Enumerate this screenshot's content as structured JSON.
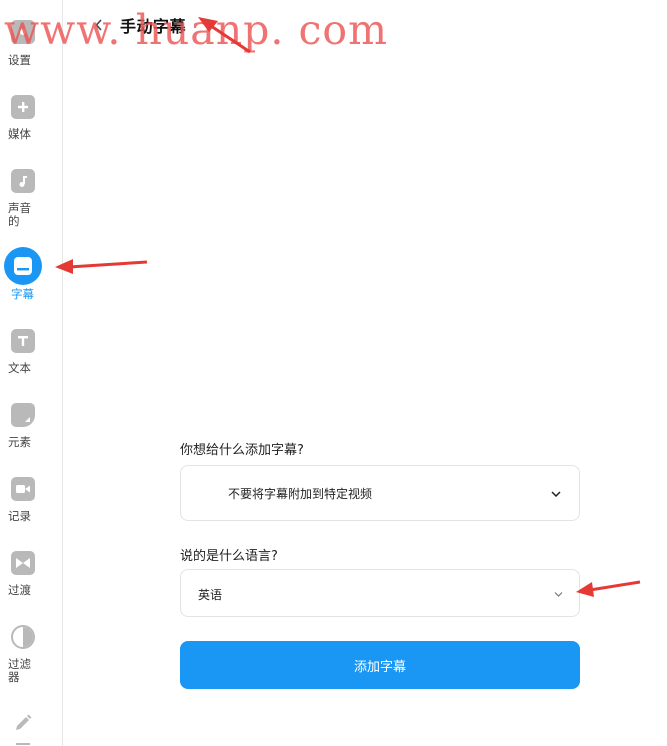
{
  "sidebar": {
    "items": [
      {
        "label": "设置",
        "icon": "settings-icon"
      },
      {
        "label": "媒体",
        "icon": "plus-icon"
      },
      {
        "label": "声音的",
        "label_line1": "声音",
        "label_line2": "的",
        "icon": "music-note-icon"
      },
      {
        "label": "字幕",
        "icon": "subtitles-icon",
        "active": true
      },
      {
        "label": "文本",
        "icon": "text-icon"
      },
      {
        "label": "元素",
        "icon": "shapes-icon"
      },
      {
        "label": "记录",
        "icon": "record-icon"
      },
      {
        "label": "过渡",
        "icon": "transition-icon"
      },
      {
        "label": "过滤器",
        "label_line1": "过滤",
        "label_line2": "器",
        "icon": "filter-icon"
      },
      {
        "label": "",
        "icon": "pencil-icon"
      }
    ]
  },
  "header": {
    "back_icon": "chevron-left-icon",
    "title": "手动字幕"
  },
  "form": {
    "video_question": "你想给什么添加字幕?",
    "video_select_value": "不要将字幕附加到特定视频",
    "language_question": "说的是什么语言?",
    "language_select_value": "英语",
    "submit_label": "添加字幕"
  },
  "watermark": "www. huanp. com",
  "colors": {
    "accent": "#1a97f5",
    "icon_gray": "#b9b9b9",
    "annotation_red": "#e53935"
  }
}
